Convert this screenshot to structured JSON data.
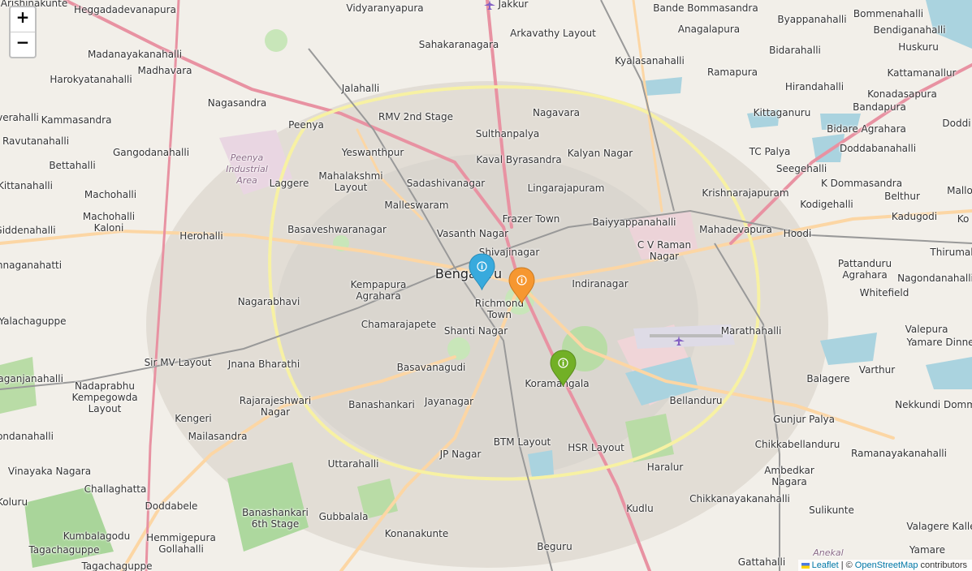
{
  "map": {
    "zoom_in_label": "+",
    "zoom_out_label": "−",
    "attribution": {
      "leaflet": "Leaflet",
      "separator": "| ©",
      "osm": "OpenStreetMap",
      "contributors": "contributors"
    },
    "markers": [
      {
        "name": "marker-bengaluru",
        "color": "#38aadd",
        "icon": "info-icon",
        "glyph": "i"
      },
      {
        "name": "marker-richmond-town",
        "color": "#f69730",
        "icon": "info-icon",
        "glyph": "i"
      },
      {
        "name": "marker-koramangala",
        "color": "#72b026",
        "icon": "info-icon",
        "glyph": "i"
      }
    ],
    "places": {
      "arishinakunte": "Arishinakunte",
      "heggadadevanapura": "Heggadadevanapura",
      "vidyaranyapura": "Vidyaranyapura",
      "jakkur": "Jakkur",
      "bande_bommasandra": "Bande Bommasandra",
      "byappanahalli": "Byappanahalli",
      "bommenahalli": "Bommenahalli",
      "bendiganahalli": "Bendiganahalli",
      "sahakaranagara": "Sahakaranagara",
      "arkavathy_layout": "Arkavathy Layout",
      "anagalapura": "Anagalapura",
      "huskuru": "Huskuru",
      "madanayakanahalli": "Madanayakanahalli",
      "kyalasanahalli": "Kyalasanahalli",
      "bidarahalli": "Bidarahalli",
      "madhavara": "Madhavara",
      "kattamanallur": "Kattamanallur",
      "ramapura": "Ramapura",
      "harokyatanahalli": "Harokyatanahalli",
      "jalahalli": "Jalahalli",
      "hirandahalli": "Hirandahalli",
      "konadasapura": "Konadasapura",
      "nagasandra": "Nagasandra",
      "nagavara": "Nagavara",
      "bandapura": "Bandapura",
      "kittaganuru": "Kittaganuru",
      "verahalli": "verahalli",
      "kammasandra": "Kammasandra",
      "rmv": "RMV 2nd Stage",
      "peenya": "Peenya",
      "doddi": "Doddi",
      "sulthanpalya": "Sulthanpalya",
      "bidare_agrahara": "Bidare Agrahara",
      "ravutanahalli": "Ravutanahalli",
      "gangodanahalli": "Gangodanahalli",
      "yeswanthpur": "Yeswanthpur",
      "kalyan_nagar": "Kalyan Nagar",
      "tc_palya": "TC Palya",
      "doddabanahalli": "Doddabanahalli",
      "peenya_area": "Peenya\nIndustrial\nArea",
      "kaval_byrasandra": "Kaval Byrasandra",
      "bettahalli": "Bettahalli",
      "seegehalli": "Seegehalli",
      "mahalakshmi": "Mahalakshmi\nLayout",
      "laggere": "Laggere",
      "sadashivanagar": "Sadashivanagar",
      "k_dommasandra": "K Dommasandra",
      "kittanahalli": "Kittanahalli",
      "lingarajapuram": "Lingarajapuram",
      "mallo": "Mallo",
      "machohalli": "Machohalli",
      "krishnarajapuram": "Krishnarajapuram",
      "belthur": "Belthur",
      "malleswaram": "Malleswaram",
      "kodigehalli": "Kodigehalli",
      "machohalli_kaloni": "Machohalli\nKaloni",
      "frazer_town": "Frazer Town",
      "kadugodi": "Kadugodi",
      "baiyyappanahalli": "Baiyyappanahalli",
      "ko": "Ko",
      "basaveshwaranagar": "Basaveshwaranagar",
      "giddenahalli": "Giddenahalli",
      "vasanth_nagar": "Vasanth Nagar",
      "mahadevapura": "Mahadevapura",
      "hoodi": "Hoodi",
      "herohalli": "Herohalli",
      "cv_raman": "C V Raman\nNagar",
      "thirumal": "Thirumal",
      "shivajinagar": "Shivajinagar",
      "pattanduru": "Pattanduru\nAgrahara",
      "nnaganahatti": "nnaganahatti",
      "bengaluru": "Bengaluru",
      "nagondanahalli": "Nagondanahalli",
      "kempapura": "Kempapura\nAgrahara",
      "indiranagar": "Indiranagar",
      "whitefield": "Whitefield",
      "nagarabhavi": "Nagarabhavi",
      "richmond_town": "Richmond\nTown",
      "yalachaguppe": "Yalachaguppe",
      "chamarajapete": "Chamarajapete",
      "shanti_nagar": "Shanti Nagar",
      "marathahalli": "Marathahalli",
      "valepura": "Valepura",
      "yamare_dinne": "Yamare Dinne",
      "sir_mv": "Sir MV Layout",
      "jnana_bharathi": "Jnana Bharathi",
      "basavanagudi": "Basavanagudi",
      "varthur": "Varthur",
      "laganjanahalli": "laganjanahalli",
      "koramangala": "Koramangala",
      "balagere": "Balagere",
      "nadaprabhu": "Nadaprabhu\nKempegowda\nLayout",
      "rajarajeshwari": "Rajarajeshwari\nNagar",
      "banashankari": "Banashankari",
      "jayanagar": "Jayanagar",
      "bellanduru": "Bellanduru",
      "nekkundi": "Nekkundi Domm",
      "kengeri": "Kengeri",
      "gunjur_palya": "Gunjur Palya",
      "ondanahalli": "ondanahalli",
      "mailasandra": "Mailasandra",
      "btm_layout": "BTM Layout",
      "hsr_layout": "HSR Layout",
      "chikkabellanduru": "Chikkabellanduru",
      "jp_nagar": "JP Nagar",
      "uttarahalli": "Uttarahalli",
      "haralur": "Haralur",
      "ramanayakanahalli": "Ramanayakanahalli",
      "vinayaka_nagara": "Vinayaka Nagara",
      "ambedkar_nagara": "Ambedkar\nNagara",
      "challaghatta": "Challaghatta",
      "chikkanayakanahalli": "Chikkanayakanahalli",
      "doddabele": "Doddabele",
      "kuluru": "Koluru",
      "banashankari_6th": "Banashankari\n6th Stage",
      "gubbalala": "Gubbalala",
      "kudlu": "Kudlu",
      "sulikunte": "Sulikunte",
      "valagere_kalle": "Valagere Kalle",
      "kumbalagodu": "Kumbalagodu",
      "hemmigepura": "Hemmigepura",
      "konanakunte": "Konanakunte",
      "tagachaguppe": "Tagachaguppe",
      "gollahalli": "Gollahalli",
      "beguru": "Beguru",
      "yamare": "Yamare",
      "gattahalli": "Gattahalli",
      "tagachaguppe2": "Tagachaguppe",
      "anekal": "Anekal"
    }
  }
}
